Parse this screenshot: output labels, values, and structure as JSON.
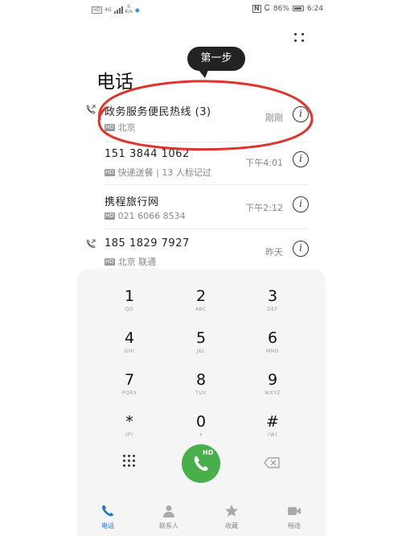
{
  "status_bar": {
    "hd_badge": "HD",
    "signal_label": "4G",
    "net_speed_value": "0",
    "net_speed_unit": "K/s",
    "battery": "86%",
    "time": "6:24"
  },
  "tooltip": "第一步",
  "page_title": "电话",
  "call_log": [
    {
      "name": "政务服务便民热线 (3)",
      "subtitle": "北京",
      "time": "刚刚",
      "has_direction_icon": true
    },
    {
      "name": "151 3844 1062",
      "subtitle": "快递送餐 | 13 人标记过",
      "time": "下午4:01",
      "has_direction_icon": false
    },
    {
      "name": "携程旅行网",
      "subtitle": "021 6066 8534",
      "time": "下午2:12",
      "has_direction_icon": false
    },
    {
      "name": "185 1829 7927",
      "subtitle": "北京 联通",
      "time": "昨天",
      "has_direction_icon": true
    }
  ],
  "dialpad": {
    "keys": [
      {
        "digit": "1",
        "letters": "QO"
      },
      {
        "digit": "2",
        "letters": "ABC"
      },
      {
        "digit": "3",
        "letters": "DEF"
      },
      {
        "digit": "4",
        "letters": "GHI"
      },
      {
        "digit": "5",
        "letters": "JKL"
      },
      {
        "digit": "6",
        "letters": "MNO"
      },
      {
        "digit": "7",
        "letters": "PQRS"
      },
      {
        "digit": "8",
        "letters": "TUV"
      },
      {
        "digit": "9",
        "letters": "WXYZ"
      },
      {
        "digit": "*",
        "letters": "(P)"
      },
      {
        "digit": "0",
        "letters": "+"
      },
      {
        "digit": "#",
        "letters": "(W)"
      }
    ],
    "call_button_badge": "HD"
  },
  "bottom_nav": [
    {
      "label": "电话",
      "icon": "phone-icon",
      "active": true
    },
    {
      "label": "联系人",
      "icon": "contacts-icon",
      "active": false
    },
    {
      "label": "收藏",
      "icon": "star-icon",
      "active": false
    },
    {
      "label": "畅连",
      "icon": "video-call-icon",
      "active": false
    }
  ],
  "colors": {
    "accent": "#1976d2",
    "call_green": "#48b04a",
    "highlight_red": "#e0332b",
    "tooltip_bg": "#222222"
  }
}
